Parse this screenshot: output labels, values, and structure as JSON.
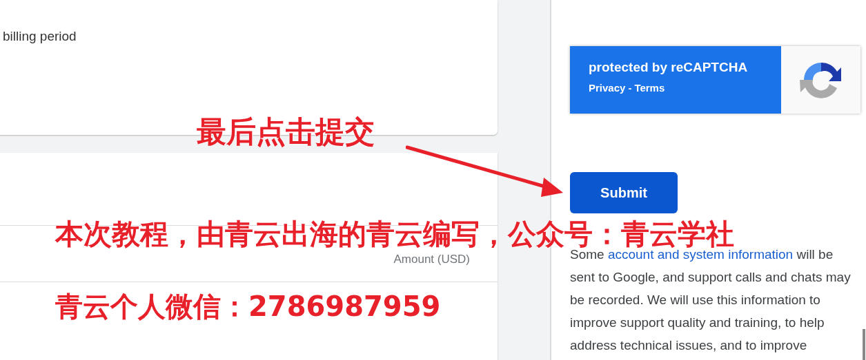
{
  "billing_card": {
    "text": "billing period"
  },
  "amount_card": {
    "column_header": "Amount (USD)"
  },
  "recaptcha": {
    "title": "protected by reCAPTCHA",
    "privacy_link": "Privacy",
    "separator": "-",
    "terms_link": "Terms"
  },
  "submit_button": {
    "label": "Submit"
  },
  "disclaimer": {
    "before": "Some ",
    "link": "account and system information",
    "after": " will be sent to Google, and support calls and chats may be recorded. We will use this information to improve support quality and training, to help address technical issues, and to improve"
  },
  "annotations": [
    {
      "kind": "callout",
      "text": "最后点击提交"
    },
    {
      "kind": "note",
      "text": "本次教程，由青云出海的青云编写，公众号：青云学社"
    },
    {
      "kind": "contact",
      "text": "青云个人微信：2786987959"
    }
  ]
}
